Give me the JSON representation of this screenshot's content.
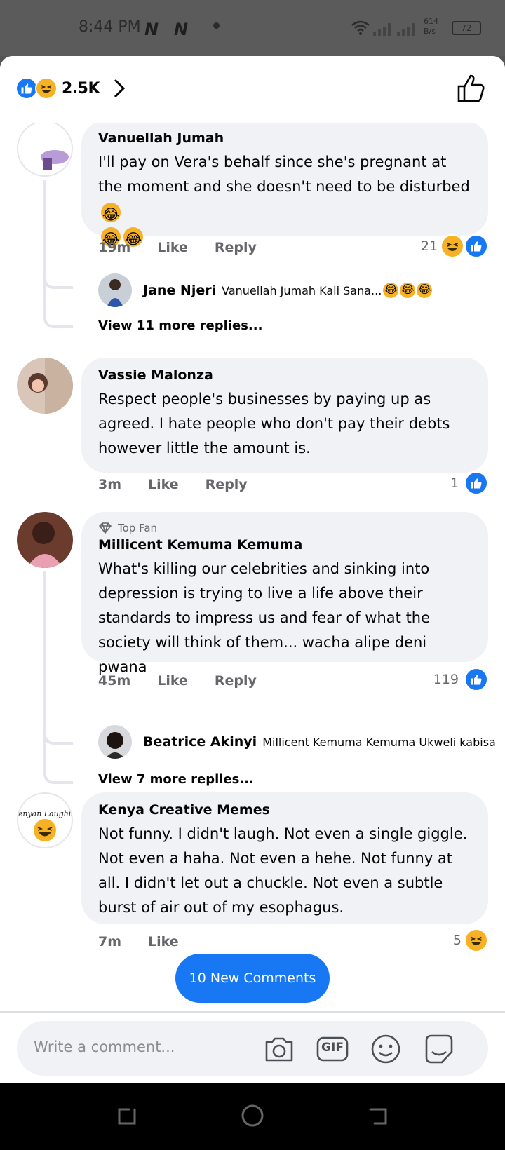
{
  "status_bar": {
    "time": "8:44 PM",
    "net_speed_value": "614",
    "net_speed_unit": "B/s",
    "battery": "72"
  },
  "header": {
    "reaction_count": "2.5K",
    "reaction_icons": [
      "like",
      "haha"
    ],
    "like_icon": "thumbs-up-outline-icon"
  },
  "comments": [
    {
      "name": "Vanuellah Jumah",
      "text": "I'll pay on Vera's behalf since she's pregnant at the moment and she doesn't need to be disturbed",
      "time": "19m",
      "like": "Like",
      "reply": "Reply",
      "reactions": "21",
      "reply_preview": {
        "name": "Jane Njeri",
        "text": "Vanuellah Jumah Kali Sana..."
      },
      "more_replies": "View 11 more replies..."
    },
    {
      "name": "Vassie Malonza",
      "text": "Respect people's businesses by paying up as agreed. I hate people who don't pay their debts however little the amount is.",
      "time": "3m",
      "like": "Like",
      "reply": "Reply",
      "reactions": "1"
    },
    {
      "badge": "Top Fan",
      "name": "Millicent Kemuma Kemuma",
      "text": "What's killing our celebrities and sinking into depression is trying to live a life above their standards to impress us and fear of what the society will think of them... wacha alipe deni pwana",
      "time": "45m",
      "like": "Like",
      "reply": "Reply",
      "reactions": "119",
      "reply_preview": {
        "name": "Beatrice Akinyi",
        "text": "Millicent Kemuma Kemuma Ukweli kabisa"
      },
      "more_replies": "View 7 more replies..."
    },
    {
      "name": "Kenya Creative Memes",
      "avatar_text": "Kenyan Laughter",
      "text": "Not funny. I didn't laugh. Not even a single giggle. Not even a haha. Not even a hehe. Not funny at all. I didn't let out a chuckle. Not even a subtle burst of air out of my esophagus.",
      "time": "7m",
      "like": "Like",
      "reactions": "5"
    }
  ],
  "new_comments_button": "10 New Comments",
  "composer": {
    "placeholder": "Write a comment...",
    "gif_label": "GIF",
    "icons": [
      "camera-icon",
      "gif-icon",
      "smiley-icon",
      "sticker-icon"
    ]
  },
  "colors": {
    "accent": "#1877f2",
    "bubble": "#f0f2f5",
    "haha": "#f7b125"
  }
}
